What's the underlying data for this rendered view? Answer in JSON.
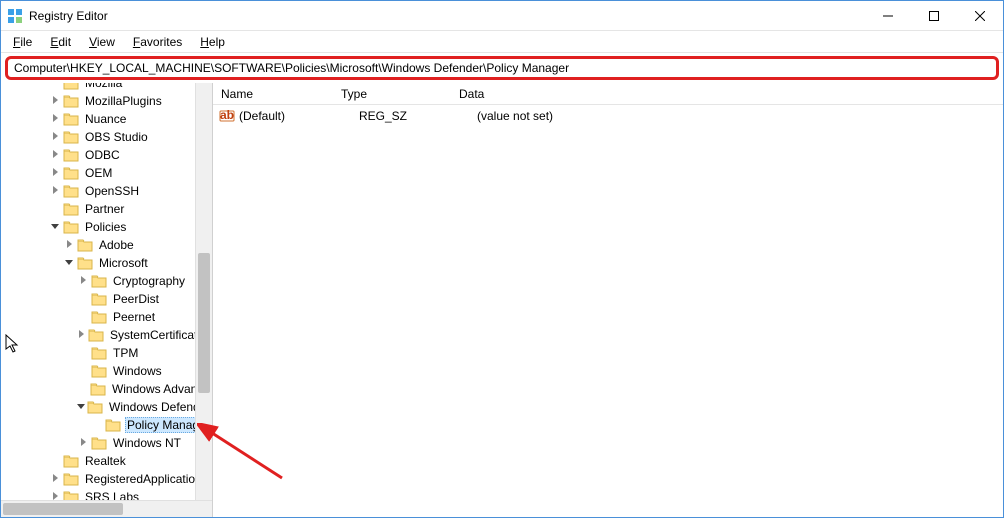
{
  "window": {
    "title": "Registry Editor"
  },
  "menu": {
    "file": "File",
    "edit": "Edit",
    "view": "View",
    "favorites": "Favorites",
    "help": "Help"
  },
  "address": {
    "path": "Computer\\HKEY_LOCAL_MACHINE\\SOFTWARE\\Policies\\Microsoft\\Windows Defender\\Policy Manager"
  },
  "tree": [
    {
      "indent": 3,
      "twisty": "none",
      "label": "Mozilla",
      "cutoff": true
    },
    {
      "indent": 3,
      "twisty": "closed",
      "label": "MozillaPlugins"
    },
    {
      "indent": 3,
      "twisty": "closed",
      "label": "Nuance"
    },
    {
      "indent": 3,
      "twisty": "closed",
      "label": "OBS Studio"
    },
    {
      "indent": 3,
      "twisty": "closed",
      "label": "ODBC"
    },
    {
      "indent": 3,
      "twisty": "closed",
      "label": "OEM"
    },
    {
      "indent": 3,
      "twisty": "closed",
      "label": "OpenSSH"
    },
    {
      "indent": 3,
      "twisty": "none",
      "label": "Partner"
    },
    {
      "indent": 3,
      "twisty": "open",
      "label": "Policies"
    },
    {
      "indent": 4,
      "twisty": "closed",
      "label": "Adobe"
    },
    {
      "indent": 4,
      "twisty": "open",
      "label": "Microsoft"
    },
    {
      "indent": 5,
      "twisty": "closed",
      "label": "Cryptography"
    },
    {
      "indent": 5,
      "twisty": "none",
      "label": "PeerDist"
    },
    {
      "indent": 5,
      "twisty": "none",
      "label": "Peernet"
    },
    {
      "indent": 5,
      "twisty": "closed",
      "label": "SystemCertificates"
    },
    {
      "indent": 5,
      "twisty": "none",
      "label": "TPM"
    },
    {
      "indent": 5,
      "twisty": "none",
      "label": "Windows"
    },
    {
      "indent": 5,
      "twisty": "none",
      "label": "Windows Advance"
    },
    {
      "indent": 5,
      "twisty": "open",
      "label": "Windows Defender"
    },
    {
      "indent": 6,
      "twisty": "none",
      "label": "Policy Manager",
      "selected": true
    },
    {
      "indent": 5,
      "twisty": "closed",
      "label": "Windows NT"
    },
    {
      "indent": 3,
      "twisty": "none",
      "label": "Realtek"
    },
    {
      "indent": 3,
      "twisty": "closed",
      "label": "RegisteredApplications"
    },
    {
      "indent": 3,
      "twisty": "closed",
      "label": "SRS Labs",
      "cutoff": true
    }
  ],
  "list": {
    "headers": {
      "name": "Name",
      "type": "Type",
      "data": "Data"
    },
    "rows": [
      {
        "name": "(Default)",
        "type": "REG_SZ",
        "data": "(value not set)"
      }
    ]
  }
}
